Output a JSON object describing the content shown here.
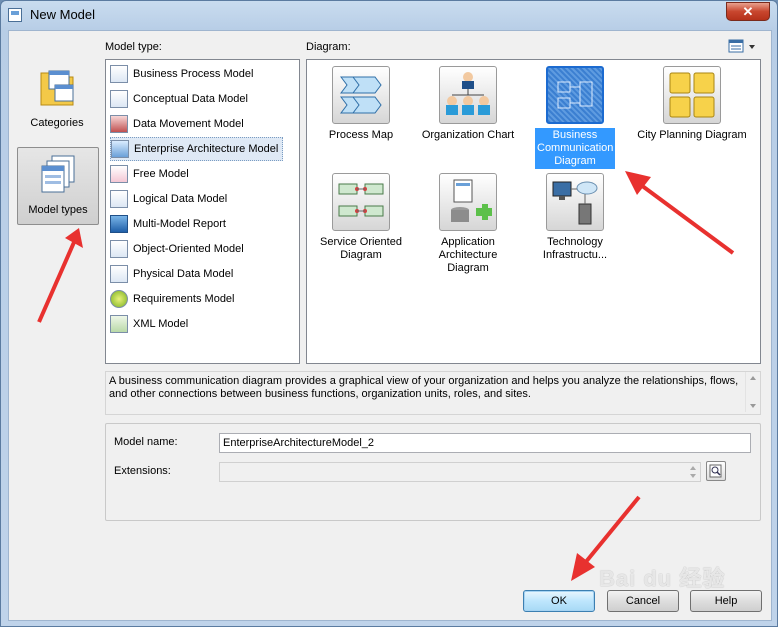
{
  "window": {
    "title": "New Model",
    "close_glyph": "✕"
  },
  "labels": {
    "model_type": "Model type:",
    "diagram": "Diagram:"
  },
  "categories": [
    {
      "label": "Categories",
      "icon": "folder-forms-icon",
      "selected": false
    },
    {
      "label": "Model types",
      "icon": "stacked-forms-icon",
      "selected": true
    }
  ],
  "model_types": [
    {
      "label": "Business Process Model",
      "icon": "business-process-model-icon"
    },
    {
      "label": "Conceptual Data Model",
      "icon": "conceptual-data-model-icon"
    },
    {
      "label": "Data Movement Model",
      "icon": "data-movement-model-icon"
    },
    {
      "label": "Enterprise Architecture Model",
      "icon": "enterprise-architecture-model-icon",
      "selected": true
    },
    {
      "label": "Free Model",
      "icon": "free-model-icon"
    },
    {
      "label": "Logical Data Model",
      "icon": "logical-data-model-icon"
    },
    {
      "label": "Multi-Model Report",
      "icon": "multi-model-report-icon"
    },
    {
      "label": "Object-Oriented Model",
      "icon": "object-oriented-model-icon"
    },
    {
      "label": "Physical Data Model",
      "icon": "physical-data-model-icon"
    },
    {
      "label": "Requirements Model",
      "icon": "requirements-model-icon"
    },
    {
      "label": "XML Model",
      "icon": "xml-model-icon"
    }
  ],
  "diagrams": [
    {
      "label": "Process Map",
      "icon": "process-map-icon"
    },
    {
      "label": "Organization Chart",
      "icon": "organization-chart-icon"
    },
    {
      "label": "Business Communication Diagram",
      "icon": "business-communication-diagram-icon",
      "selected": true
    },
    {
      "label": "City Planning Diagram",
      "icon": "city-planning-diagram-icon"
    },
    {
      "label": "Service Oriented Diagram",
      "icon": "service-oriented-diagram-icon"
    },
    {
      "label": "Application Architecture Diagram",
      "icon": "application-architecture-diagram-icon"
    },
    {
      "label": "Technology Infrastructu...",
      "icon": "technology-infrastructure-icon"
    }
  ],
  "description": "A business communication diagram provides a graphical view of your organization and helps you analyze the relationships, flows, and other connections between business functions, organization units, roles, and sites.",
  "form": {
    "model_name_label": "Model name:",
    "model_name_value": "EnterpriseArchitectureModel_2",
    "extensions_label": "Extensions:",
    "extensions_value": ""
  },
  "buttons": {
    "ok": "OK",
    "cancel": "Cancel",
    "help": "Help"
  },
  "watermark": "Bai du 经验",
  "colors": {
    "selection": "#3399ff",
    "annotation_arrow": "#e8312f"
  }
}
